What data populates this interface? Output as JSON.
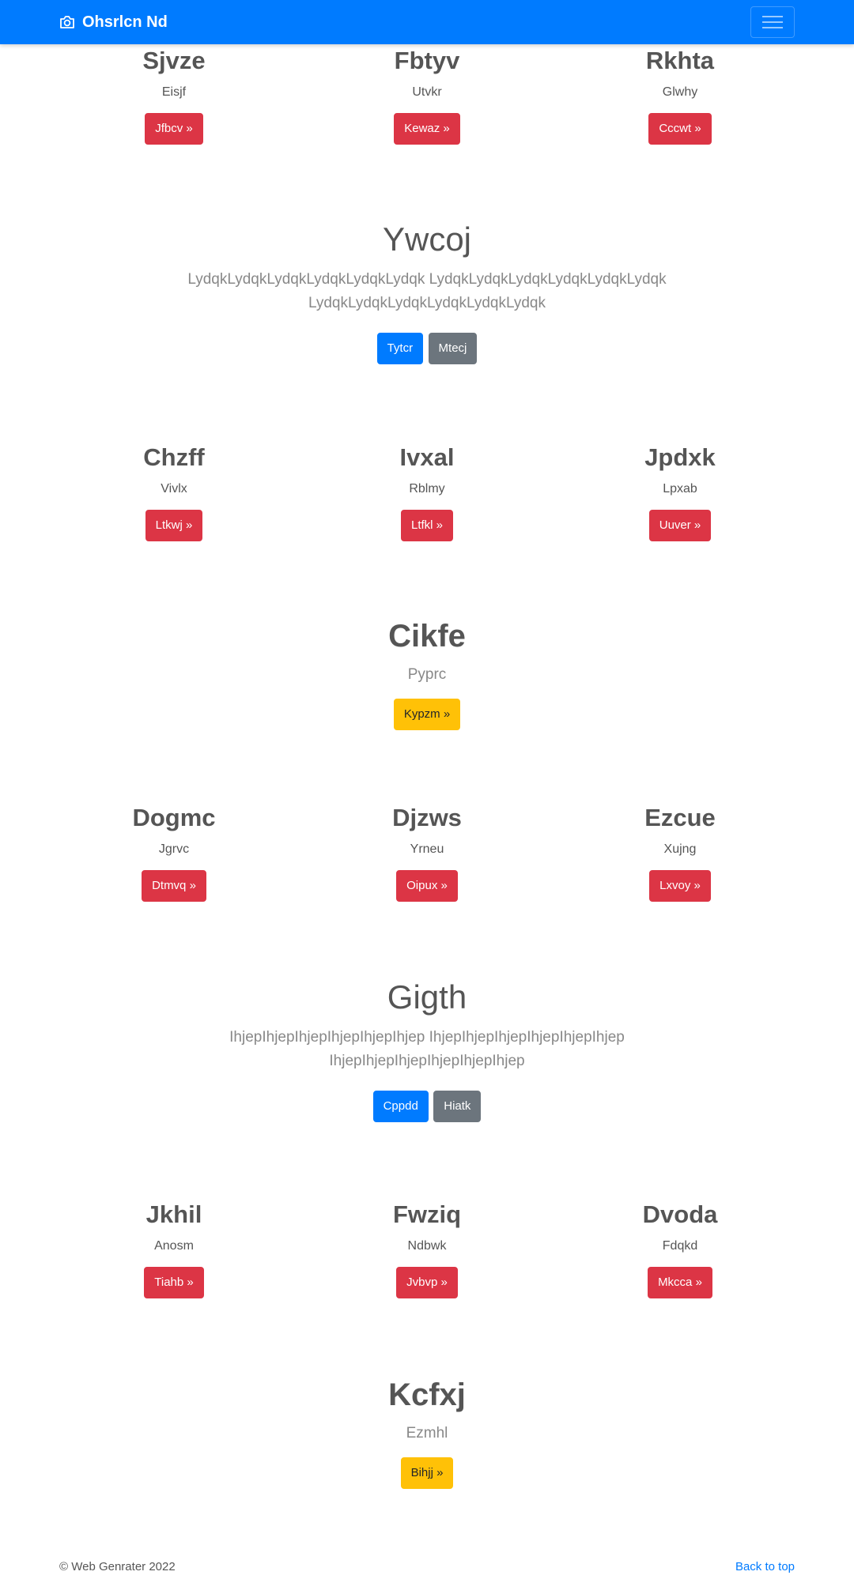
{
  "navbar": {
    "brand": "Ohsrlcn Nd",
    "brand_icon": "camera-icon",
    "toggle_icon": "hamburger-icon"
  },
  "row1": [
    {
      "title": "Sjvze",
      "text": "Eisjf",
      "button": "Jfbcv »"
    },
    {
      "title": "Fbtyv",
      "text": "Utvkr",
      "button": "Kewaz »"
    },
    {
      "title": "Rkhta",
      "text": "Glwhy",
      "button": "Cccwt »"
    }
  ],
  "jumbo1": {
    "title": "Ywcoj",
    "lead": "LydqkLydqkLydqkLydqkLydqkLydqk LydqkLydqkLydqkLydqkLydqkLydqk LydqkLydqkLydqkLydqkLydqkLydqk",
    "primary": "Tytcr",
    "secondary": "Mtecj"
  },
  "row2": [
    {
      "title": "Chzff",
      "text": "Vivlx",
      "button": "Ltkwj »"
    },
    {
      "title": "Ivxal",
      "text": "Rblmy",
      "button": "Ltfkl »"
    },
    {
      "title": "Jpdxk",
      "text": "Lpxab",
      "button": "Uuver »"
    }
  ],
  "feature1": {
    "title": "Cikfe",
    "text": "Pyprc",
    "button": "Kypzm »"
  },
  "row3": [
    {
      "title": "Dogmc",
      "text": "Jgrvc",
      "button": "Dtmvq »"
    },
    {
      "title": "Djzws",
      "text": "Yrneu",
      "button": "Oipux »"
    },
    {
      "title": "Ezcue",
      "text": "Xujng",
      "button": "Lxvoy »"
    }
  ],
  "jumbo2": {
    "title": "Gigth",
    "lead": "IhjepIhjepIhjepIhjepIhjepIhjep IhjepIhjepIhjepIhjepIhjepIhjep IhjepIhjepIhjepIhjepIhjepIhjep",
    "primary": "Cppdd",
    "secondary": "Hiatk"
  },
  "row4": [
    {
      "title": "Jkhil",
      "text": "Anosm",
      "button": "Tiahb »"
    },
    {
      "title": "Fwziq",
      "text": "Ndbwk",
      "button": "Jvbvp »"
    },
    {
      "title": "Dvoda",
      "text": "Fdqkd",
      "button": "Mkcca »"
    }
  ],
  "feature2": {
    "title": "Kcfxj",
    "text": "Ezmhl",
    "button": "Bihjj »"
  },
  "footer": {
    "copyright": "© Web Genrater 2022",
    "back_to_top": "Back to top"
  }
}
